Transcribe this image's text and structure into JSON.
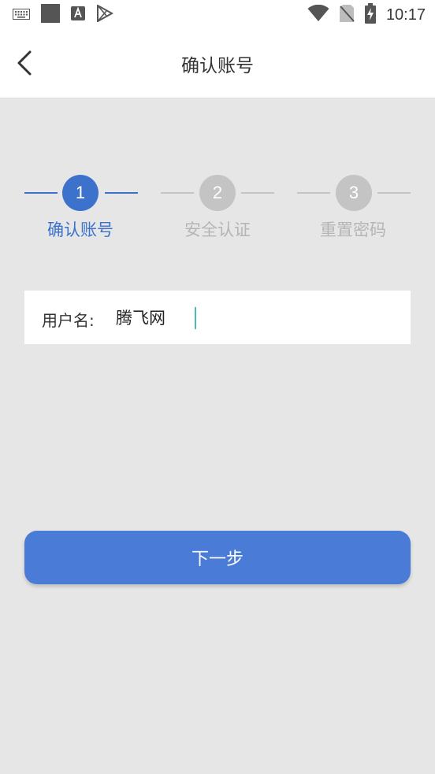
{
  "status_bar": {
    "time": "10:17",
    "left_icons": [
      "keyboard-icon",
      "square-app-icon",
      "font-app-icon",
      "play-store-icon"
    ],
    "right_icons": [
      "wifi-icon",
      "no-sim-icon",
      "battery-charging-icon"
    ]
  },
  "header": {
    "title": "确认账号",
    "back_icon": "chevron-left-icon"
  },
  "steps": [
    {
      "number": "1",
      "label": "确认账号",
      "active": true
    },
    {
      "number": "2",
      "label": "安全认证",
      "active": false
    },
    {
      "number": "3",
      "label": "重置密码",
      "active": false
    }
  ],
  "form": {
    "username_label": "用户名:",
    "username_value": "腾飞网"
  },
  "next_button": {
    "label": "下一步"
  },
  "colors": {
    "accent": "#4a7bd6",
    "step_active": "#3c72cc",
    "step_inactive": "#c4c4c4",
    "step_label_inactive": "#b5b5b5",
    "background": "#e6e6e6",
    "caret": "#4dbbb5"
  }
}
